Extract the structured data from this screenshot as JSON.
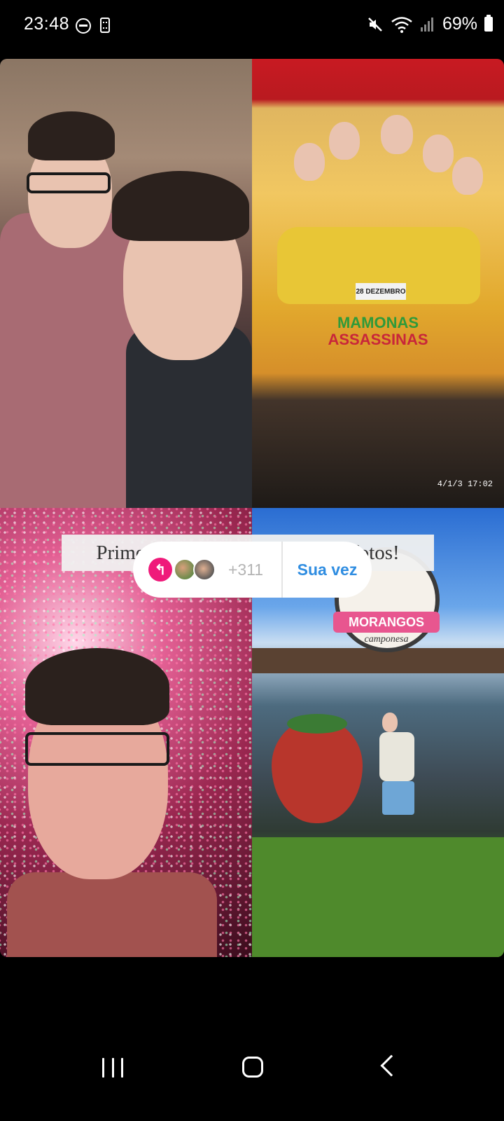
{
  "status_bar": {
    "time": "23:48",
    "battery": "69%",
    "icons": [
      "do-not-disturb-icon",
      "sim-card-icon",
      "mute-icon",
      "wifi-icon",
      "signal-icon",
      "battery-icon"
    ]
  },
  "story": {
    "caption": "Primeira semana de 2024 em 4 fotos!",
    "photo_timestamp": "4/1/3 17:02",
    "poster": {
      "title_line1": "MAMONAS",
      "title_line2": "ASSASSINAS",
      "date": "28 DEZEMBRO"
    },
    "sign": {
      "line1": "MORANGOS",
      "line2": "camponesa"
    }
  },
  "add_yours": {
    "count": "+311",
    "action_label": "Sua vez"
  },
  "colors": {
    "accent_pink": "#ef1a7a",
    "link_blue": "#2f8de1"
  }
}
